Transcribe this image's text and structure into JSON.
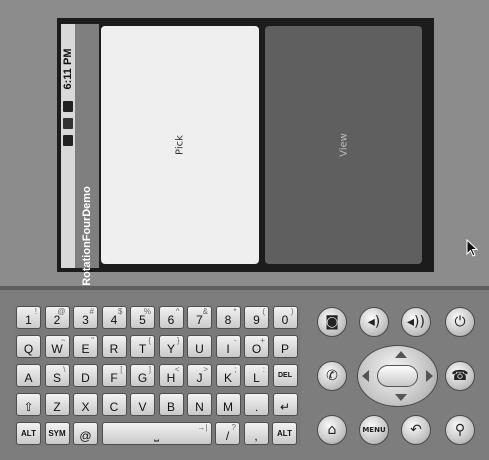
{
  "app": {
    "title": "RotationFourDemo"
  },
  "status_bar": {
    "time": "6:11 PM",
    "icons": [
      "usb-icon",
      "signal-icon",
      "battery-icon"
    ]
  },
  "fragments": {
    "pick_label": "Pick",
    "view_label": "View"
  },
  "keyboard": {
    "rows": [
      [
        {
          "main": "1",
          "sub": "!"
        },
        {
          "main": "2",
          "sub": "@"
        },
        {
          "main": "3",
          "sub": "#"
        },
        {
          "main": "4",
          "sub": "$"
        },
        {
          "main": "5",
          "sub": "%"
        },
        {
          "main": "6",
          "sub": "^"
        },
        {
          "main": "7",
          "sub": "&"
        },
        {
          "main": "8",
          "sub": "*"
        },
        {
          "main": "9",
          "sub": "("
        },
        {
          "main": "0",
          "sub": ")"
        }
      ],
      [
        {
          "main": "Q",
          "sub": ""
        },
        {
          "main": "W",
          "sub": "~"
        },
        {
          "main": "E",
          "sub": "\""
        },
        {
          "main": "R",
          "sub": ""
        },
        {
          "main": "T",
          "sub": "{"
        },
        {
          "main": "Y",
          "sub": "}"
        },
        {
          "main": "U",
          "sub": ""
        },
        {
          "main": "I",
          "sub": "-"
        },
        {
          "main": "O",
          "sub": "+"
        },
        {
          "main": "P",
          "sub": ""
        }
      ],
      [
        {
          "main": "A",
          "sub": ""
        },
        {
          "main": "S",
          "sub": "\\"
        },
        {
          "main": "D",
          "sub": ""
        },
        {
          "main": "F",
          "sub": "["
        },
        {
          "main": "G",
          "sub": "]"
        },
        {
          "main": "H",
          "sub": "<"
        },
        {
          "main": "J",
          "sub": ">"
        },
        {
          "main": "K",
          "sub": ";"
        },
        {
          "main": "L",
          "sub": ":"
        },
        {
          "main": "DEL",
          "sub": ""
        }
      ],
      [
        {
          "main": "⇧",
          "sub": ""
        },
        {
          "main": "Z",
          "sub": ""
        },
        {
          "main": "X",
          "sub": ""
        },
        {
          "main": "C",
          "sub": ""
        },
        {
          "main": "V",
          "sub": ""
        },
        {
          "main": "B",
          "sub": ""
        },
        {
          "main": "N",
          "sub": ""
        },
        {
          "main": "M",
          "sub": ""
        },
        {
          "main": ".",
          "sub": ""
        },
        {
          "main": "↵",
          "sub": ""
        }
      ],
      [
        {
          "main": "ALT",
          "sub": ""
        },
        {
          "main": "SYM",
          "sub": ""
        },
        {
          "main": "@",
          "sub": ""
        },
        {
          "main": "⎵",
          "sub": "→|"
        },
        {
          "main": "/",
          "sub": "?"
        },
        {
          "main": ",",
          "sub": ""
        },
        {
          "main": "ALT",
          "sub": ""
        }
      ]
    ]
  },
  "hardware_buttons": {
    "top": [
      "camera-icon",
      "volume-down-icon",
      "volume-up-icon",
      "power-icon"
    ],
    "menu_label": "MENU"
  }
}
